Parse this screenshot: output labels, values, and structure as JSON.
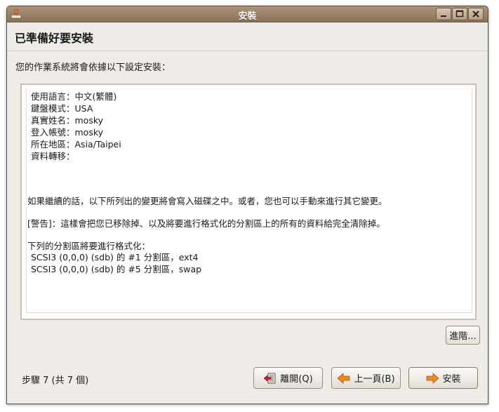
{
  "window": {
    "title": "安裝"
  },
  "page": {
    "title": "已準備好要安裝",
    "intro": "您的作業系統將會依據以下設定安裝："
  },
  "summary": {
    "settings": [
      "使用語言：中文(繁體)",
      "鍵盤模式：USA",
      "真實姓名：mosky",
      "登入帳號：mosky",
      "所在地區：Asia/Taipei",
      "資料轉移："
    ],
    "continue_note": "如果繼續的話，以下所列出的變更將會寫入磁碟之中。或者，您也可以手動來進行其它變更。",
    "warning": "[警告]：這樣會把您已移除掉、以及將要進行格式化的分割區上的所有的資料給完全清除掉。",
    "format_heading": "下列的分割區將要進行格式化：",
    "partitions": [
      "SCSI3 (0,0,0) (sdb) 的 #1 分割區，ext4",
      "SCSI3 (0,0,0) (sdb) 的 #5 分割區，swap"
    ]
  },
  "buttons": {
    "advanced": "進階...",
    "quit": "離開(Q)",
    "back": "上一頁(B)",
    "install": "安裝"
  },
  "step": "步驟 7 (共 7 個)",
  "colors": {
    "titlebar": "#9a8168",
    "window_bg": "#efebe7",
    "arrow_orange": "#f08a1c",
    "quit_red": "#d52020"
  }
}
